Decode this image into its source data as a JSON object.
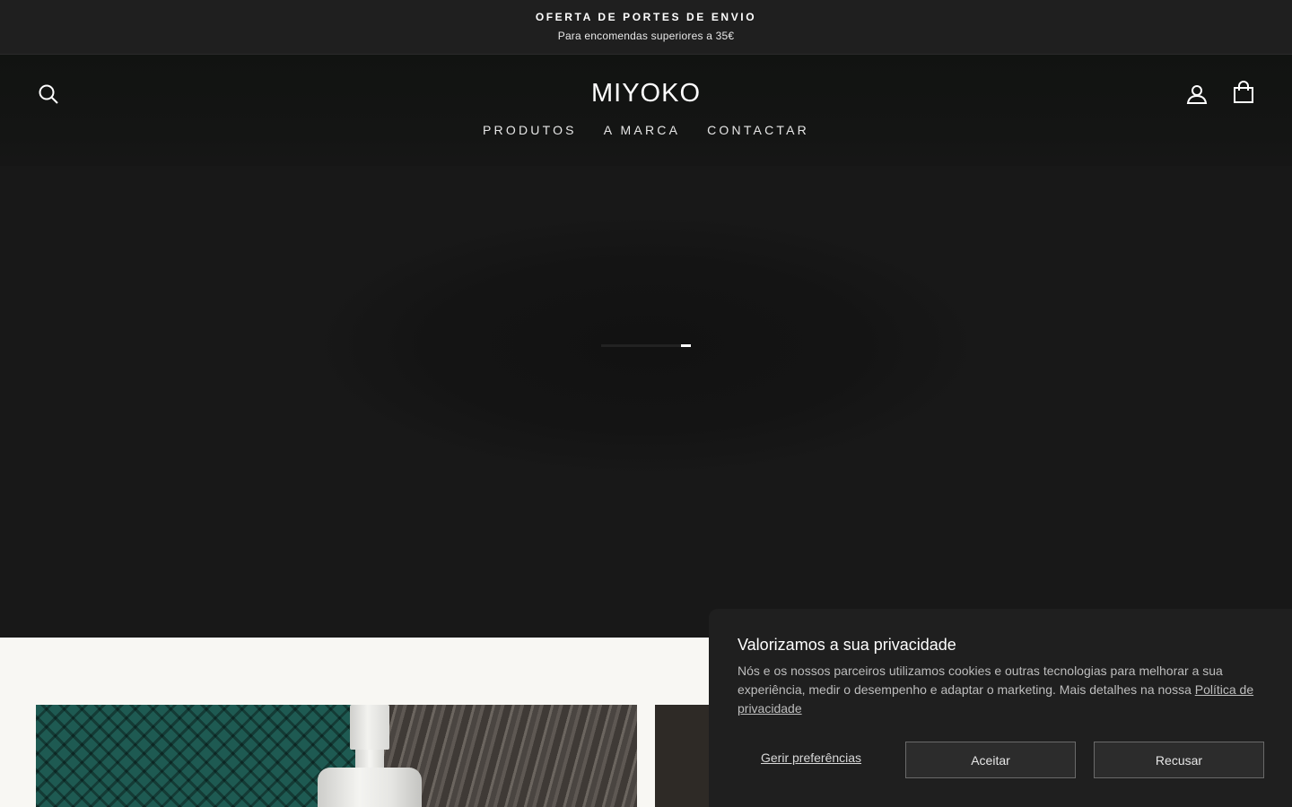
{
  "announcement": {
    "title": "OFERTA DE PORTES DE ENVIO",
    "subtitle": "Para encomendas superiores a 35€"
  },
  "header": {
    "logo": "MIYOKO",
    "icons": {
      "search": "search-icon",
      "account": "user-icon",
      "cart": "shopping-bag-icon"
    },
    "nav": [
      {
        "label": "PRODUTOS"
      },
      {
        "label": "A MARCA"
      },
      {
        "label": "CONTACTAR"
      }
    ]
  },
  "hero": {
    "loading_progress": 0.11
  },
  "cookie_banner": {
    "title": "Valorizamos a sua privacidade",
    "body": "Nós e os nossos parceiros utilizamos cookies e outras tecnologias para melhorar a sua experiência, medir o desempenho e adaptar o marketing. Mais detalhes na nossa ",
    "policy_link": "Política de privacidade",
    "manage_label": "Gerir preferências",
    "accept_label": "Aceitar",
    "decline_label": "Recusar"
  },
  "colors": {
    "background": "#1a1a1a",
    "section_background": "#f8f7f3",
    "banner_background": "#1f1f1f"
  }
}
